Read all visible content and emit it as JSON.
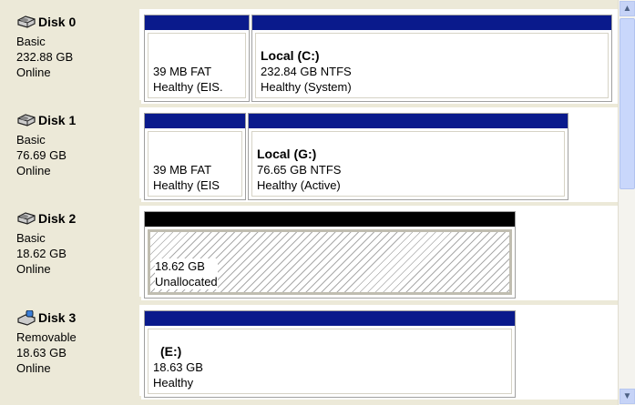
{
  "disks": [
    {
      "name": "Disk 0",
      "type": "Basic",
      "size": "232.88 GB",
      "status": "Online",
      "icon": "hard-disk-icon",
      "volumes": [
        {
          "name": "",
          "line1": "39 MB FAT",
          "line2": "Healthy (EIS."
        },
        {
          "name": "Local  (C:)",
          "line1": "232.84 GB NTFS",
          "line2": "Healthy (System)"
        }
      ]
    },
    {
      "name": "Disk 1",
      "type": "Basic",
      "size": "76.69 GB",
      "status": "Online",
      "icon": "hard-disk-icon",
      "volumes": [
        {
          "name": "",
          "line1": "39 MB FAT",
          "line2": "Healthy (EIS"
        },
        {
          "name": "Local  (G:)",
          "line1": "76.65 GB NTFS",
          "line2": "Healthy (Active)"
        }
      ]
    },
    {
      "name": "Disk 2",
      "type": "Basic",
      "size": "18.62 GB",
      "status": "Online",
      "icon": "hard-disk-icon",
      "volumes": [
        {
          "name": "",
          "line1": "18.62 GB",
          "line2": "Unallocated"
        }
      ]
    },
    {
      "name": "Disk 3",
      "type": "Removable",
      "size": "18.63 GB",
      "status": "Online",
      "icon": "removable-disk-icon",
      "volumes": [
        {
          "name": "(E:)",
          "line1": "18.63 GB",
          "line2": "Healthy"
        }
      ]
    }
  ],
  "scrollbar": {
    "up_icon": "chevron-up-icon",
    "down_icon": "chevron-down-icon"
  },
  "colors": {
    "primary_bar": "#0a1a8c",
    "unallocated_bar": "#000000",
    "panel_bg": "#ece9d8"
  }
}
